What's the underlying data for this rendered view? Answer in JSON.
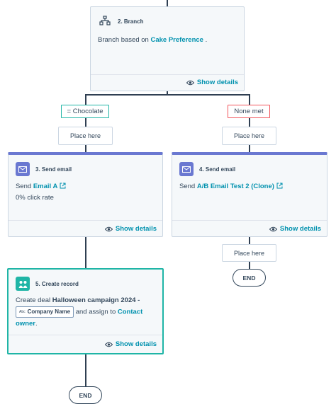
{
  "branch": {
    "title": "2. Branch",
    "body_prefix": "Branch based on",
    "property": "Cake Preference",
    "body_suffix": ".",
    "details": "Show details"
  },
  "branches": {
    "left_label": "= Chocolate",
    "right_label": "None met",
    "left_placeholder": "Place here",
    "right_placeholder": "Place here",
    "right_after_placeholder": "Place here"
  },
  "email_a": {
    "title": "3. Send email",
    "send_word": "Send",
    "email_name": "Email A",
    "click_rate": "0% click rate",
    "details": "Show details"
  },
  "email_b": {
    "title": "4. Send email",
    "send_word": "Send",
    "email_name": "A/B Email Test 2 (Clone)",
    "details": "Show details"
  },
  "create_record": {
    "title": "5. Create record",
    "prefix": "Create deal",
    "deal_name": "Halloween campaign 2024 -",
    "chip_prefix": "Abc",
    "chip_label": "Company Name",
    "assign_text": "and assign to",
    "owner_1": "Contact",
    "owner_2": "owner",
    "suffix": ".",
    "details": "Show details"
  },
  "ends": {
    "right": "END",
    "left": "END"
  },
  "colors": {
    "teal": "#1fb5a6",
    "link": "#0091ae",
    "email_accent": "#6a78d1",
    "none_met": "#f2545b"
  }
}
